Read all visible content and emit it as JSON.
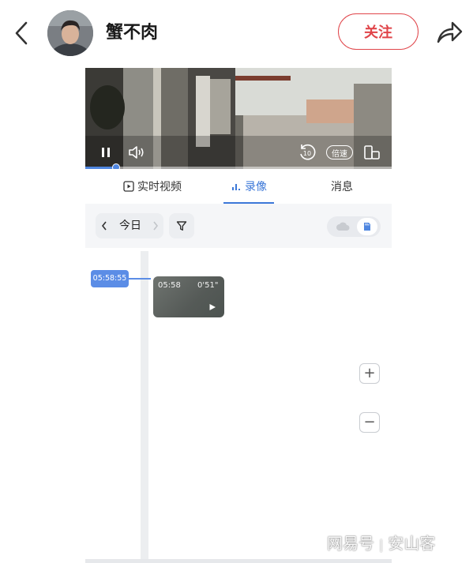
{
  "header": {
    "author_name": "蟹不肉",
    "follow_label": "关注"
  },
  "player": {
    "speed_label": "倍速",
    "progress_fraction": 0.1
  },
  "tabs": [
    {
      "label": "实时视频"
    },
    {
      "label": "录像"
    },
    {
      "label": "消息"
    }
  ],
  "toolbar": {
    "date_label": "今日"
  },
  "timeline": {
    "current_time": "05:58:55",
    "clip": {
      "start_time": "05:58",
      "duration": "0'51\""
    },
    "zoom_in_label": "+",
    "zoom_out_label": "−"
  },
  "watermark": {
    "source": "网易号",
    "separator": "|",
    "author": "安山客"
  },
  "colors": {
    "accent": "#3c78d8",
    "follow": "#e0454a",
    "badge": "#5b8de6"
  }
}
